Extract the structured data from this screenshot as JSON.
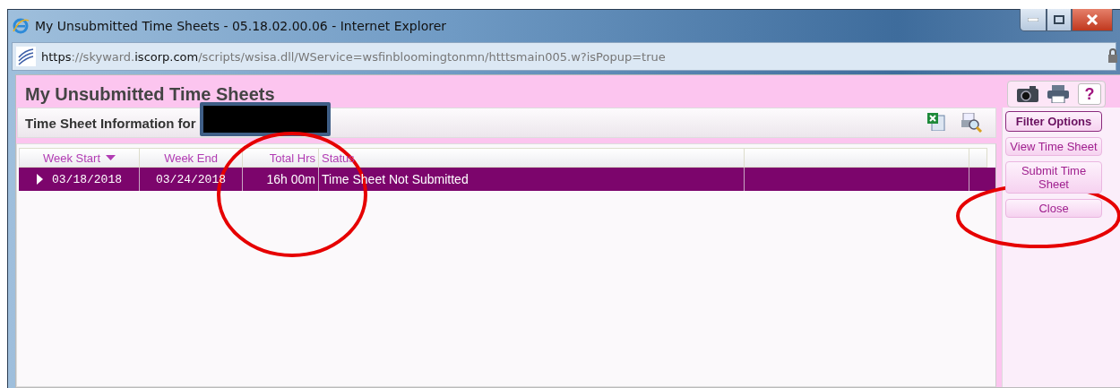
{
  "window": {
    "title": "My Unsubmitted Time Sheets - 05.18.02.00.06 - Internet Explorer"
  },
  "address": {
    "scheme": "https",
    "host": "://skyward.",
    "domain": "iscorp.com",
    "path": "/scripts/wsisa.dll/WService=wsfinbloomingtonmn/htttsmain005.w?isPopup=true"
  },
  "page": {
    "heading": "My Unsubmitted Time Sheets",
    "help": "?"
  },
  "panel": {
    "title": "Time Sheet Information for",
    "redacted": true
  },
  "table": {
    "columns": [
      {
        "label": "Week Start",
        "sorted": true
      },
      {
        "label": "Week End",
        "sorted": false
      },
      {
        "label": "Total Hrs",
        "sorted": false
      },
      {
        "label": "Status",
        "sorted": false
      }
    ],
    "rows": [
      {
        "selected": true,
        "expanded": false,
        "cells": [
          "03/18/2018",
          "03/24/2018",
          "16h 00m",
          "Time Sheet Not Submitted"
        ]
      }
    ]
  },
  "buttons": [
    {
      "label": "Filter Options",
      "kind": "primary"
    },
    {
      "label": "View Time Sheet",
      "kind": "normal"
    },
    {
      "label": "Submit Time Sheet",
      "kind": "normal"
    },
    {
      "label": "Close",
      "kind": "normal"
    }
  ],
  "annotations": [
    {
      "kind": "circle"
    },
    {
      "kind": "circle"
    }
  ]
}
